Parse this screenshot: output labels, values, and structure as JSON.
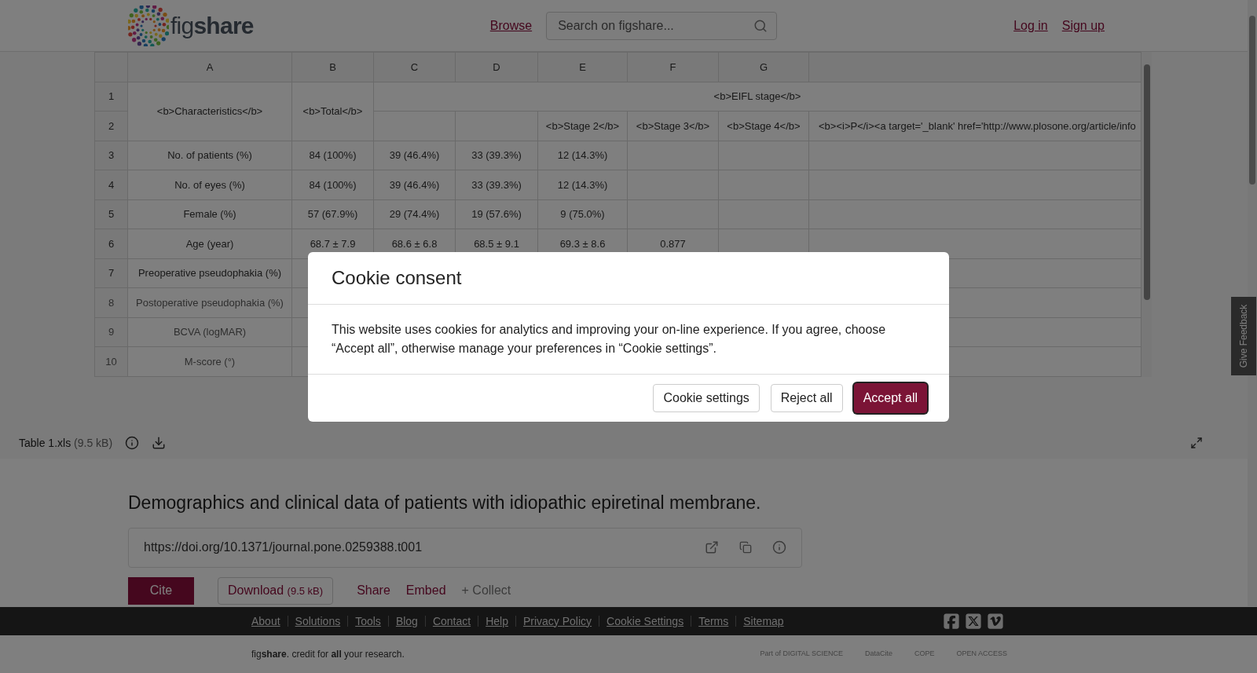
{
  "header": {
    "logo": "fig**share**",
    "nav_link": "Browse",
    "search": {
      "placeholder": "Search on figshare..."
    },
    "account_links": [
      "Log in",
      "Sign up"
    ]
  },
  "spreadsheet": {
    "columns": [
      "A",
      "B",
      "C",
      "D",
      "E",
      "F",
      "G"
    ],
    "header_rows": {
      "numbers": [
        "1",
        "2"
      ],
      "characteristics": "<b>Characteristics</b>",
      "total": "<b>Total</b>",
      "group": "<b>EIFL stage</b>",
      "subheads": [
        "<b>Stage 2</b>",
        "<b>Stage 3</b>",
        "<b>Stage 4</b>",
        "<b><i>P</i><a target='_blank' href='http://www.plosone.org/article/info"
      ]
    },
    "rows": [
      {
        "number": "3",
        "faded": false,
        "values": [
          "No. of patients (%)",
          "84 (100%)",
          "39 (46.4%)",
          "33 (39.3%)",
          "12 (14.3%)"
        ]
      },
      {
        "number": "4",
        "faded": false,
        "values": [
          "No. of eyes (%)",
          "84 (100%)",
          "39 (46.4%)",
          "33 (39.3%)",
          "12 (14.3%)"
        ]
      },
      {
        "number": "5",
        "faded": false,
        "values": [
          "Female (%)",
          "57 (67.9%)",
          "29 (74.4%)",
          "19 (57.6%)",
          "9 (75.0%)"
        ]
      },
      {
        "number": "6",
        "faded": false,
        "values": [
          "Age (year)",
          "68.7 ± 7.9",
          "68.6 ± 6.8",
          "68.5 ± 9.1",
          "69.3 ± 8.6",
          "0.877"
        ]
      },
      {
        "number": "7",
        "faded": false,
        "values": [
          "Preoperative pseudophakia (%)"
        ]
      },
      {
        "number": "8",
        "faded": true,
        "values": [
          "Postoperative pseudophakia (%)"
        ]
      },
      {
        "number": "9",
        "faded": true,
        "values": [
          "BCVA (logMAR)"
        ]
      },
      {
        "number": "10",
        "faded": true,
        "values": [
          "M-score (°)"
        ]
      }
    ]
  },
  "file_bar": {
    "name": "Table 1.xls",
    "size": "(9.5 kB)"
  },
  "item": {
    "title": "Demographics and clinical data of patients with idiopathic epiretinal membrane.",
    "doi": "https://doi.org/10.1371/journal.pone.0259388.t001",
    "actions": [
      {
        "kind": "primary",
        "label": "Cite"
      },
      {
        "kind": "outline",
        "label": "Download",
        "extra": "(9.5 kB)"
      },
      {
        "kind": "link",
        "label": "Share"
      },
      {
        "kind": "link",
        "label": "Embed"
      },
      {
        "kind": "muted",
        "label": "+ Collect"
      }
    ]
  },
  "feedback_tab": "Give Feedback",
  "footer": {
    "links": [
      "About",
      "Solutions",
      "Tools",
      "Blog",
      "Contact",
      "Help",
      "Privacy Policy",
      "Cookie Settings",
      "Terms",
      "Sitemap"
    ],
    "tagline": "fig**share**. credit for **all** your research.",
    "partners": [
      "Part of DIGITAL SCIENCE",
      "DataCite",
      "COPE",
      "OPEN ACCESS"
    ]
  },
  "cookie_dialog": {
    "title": "Cookie consent",
    "text": "This website uses cookies for analytics and improving your on-line experience. If you agree, choose “Accept all”, otherwise manage your preferences in “Cookie settings”.",
    "buttons": [
      {
        "label": "Cookie settings",
        "primary": false
      },
      {
        "label": "Reject all",
        "primary": false
      },
      {
        "label": "Accept all",
        "primary": true
      }
    ]
  }
}
